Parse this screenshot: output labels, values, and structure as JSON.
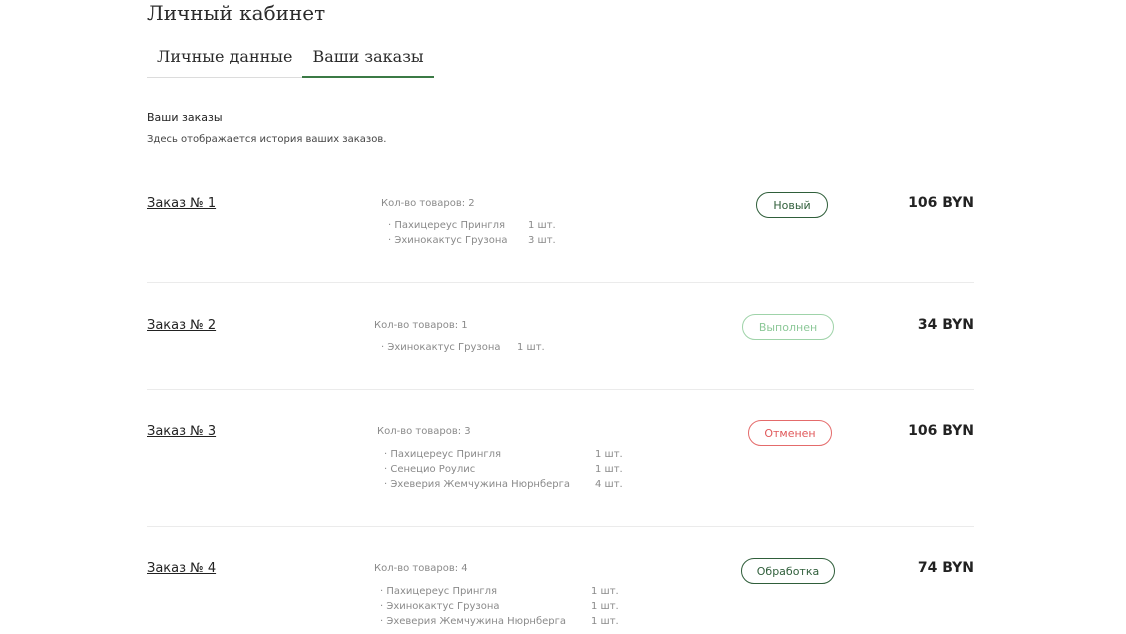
{
  "page": {
    "title": "Личный кабинет"
  },
  "tabs": [
    {
      "label": "Личные данные",
      "active": false
    },
    {
      "label": "Ваши заказы",
      "active": true
    }
  ],
  "orders_section": {
    "title": "Ваши заказы",
    "description": "Здесь отображается история ваших заказов."
  },
  "orders": [
    {
      "number_label": "Заказ № 1",
      "items_count_label": "Кол-во товаров: 2",
      "items": [
        {
          "name": "· Пахицереус Прингля",
          "qty": "1 шт."
        },
        {
          "name": "· Эхинокактус Грузона",
          "qty": "3 шт."
        }
      ],
      "status": "Новый",
      "total": "106 BYN"
    },
    {
      "number_label": "Заказ № 2",
      "items_count_label": "Кол-во товаров: 1",
      "items": [
        {
          "name": "· Эхинокактус Грузона",
          "qty": "1 шт."
        }
      ],
      "status": "Выполнен",
      "total": "34 BYN"
    },
    {
      "number_label": "Заказ № 3",
      "items_count_label": "Кол-во товаров: 3",
      "items": [
        {
          "name": "· Пахицереус Прингля",
          "qty": "1 шт."
        },
        {
          "name": "· Сенецио Роулис",
          "qty": "1 шт."
        },
        {
          "name": "· Эхеверия Жемчужина Нюрнберга",
          "qty": "4 шт."
        }
      ],
      "status": "Отменен",
      "total": "106 BYN"
    },
    {
      "number_label": "Заказ № 4",
      "items_count_label": "Кол-во товаров: 4",
      "items": [
        {
          "name": "· Пахицереус Прингля",
          "qty": "1 шт."
        },
        {
          "name": "· Эхинокактус Грузона",
          "qty": "1 шт."
        },
        {
          "name": "· Эхеверия Жемчужина Нюрнберга",
          "qty": "1 шт."
        }
      ],
      "status": "Обработка",
      "total": "74 BYN"
    }
  ],
  "colors": {
    "accent": "#3b7a45",
    "status_new": "#2f5e3a",
    "status_done": "#8cc898",
    "status_cancelled": "#e0585a",
    "status_processing": "#2f5e3a"
  }
}
